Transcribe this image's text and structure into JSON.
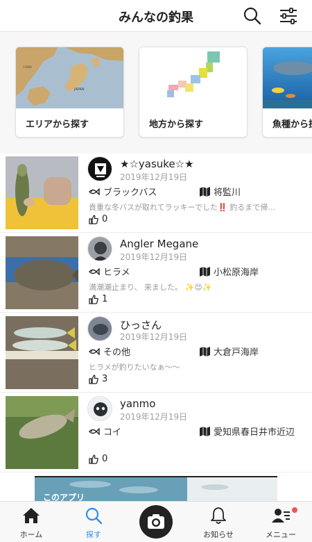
{
  "header": {
    "title": "みんなの釣果"
  },
  "categories": [
    {
      "label": "エリアから探す"
    },
    {
      "label": "地方から探す"
    },
    {
      "label": "魚種から探す"
    }
  ],
  "posts": [
    {
      "user": "★☆yasuke☆★",
      "date": "2019年12月19日",
      "fish": "ブラックバス",
      "place": "将監川",
      "comment": "貴重な冬バスが取れてラッキーでした‼️ 釣るまで帰…",
      "likes": "0"
    },
    {
      "user": "Angler Megane",
      "date": "2019年12月19日",
      "fish": "ヒラメ",
      "place": "小松原海岸",
      "comment": "満潮潮止まり、 来ました。 ✨😍✨",
      "likes": "1"
    },
    {
      "user": "ひっさん",
      "date": "2019年12月19日",
      "fish": "その他",
      "place": "大倉戸海岸",
      "comment": "ヒラメが釣りたいなぁ〜〜",
      "likes": "3"
    },
    {
      "user": "yanmo",
      "date": "2019年12月19日",
      "fish": "コイ",
      "place": "愛知県春日井市近辺",
      "comment": "",
      "likes": "0"
    }
  ],
  "ad": {
    "text": "このアプリ"
  },
  "nav": {
    "home": "ホーム",
    "explore": "探す",
    "notifications": "お知らせ",
    "menu": "メニュー"
  },
  "colors": {
    "accent": "#2f8ee8",
    "badge": "#e55555"
  }
}
